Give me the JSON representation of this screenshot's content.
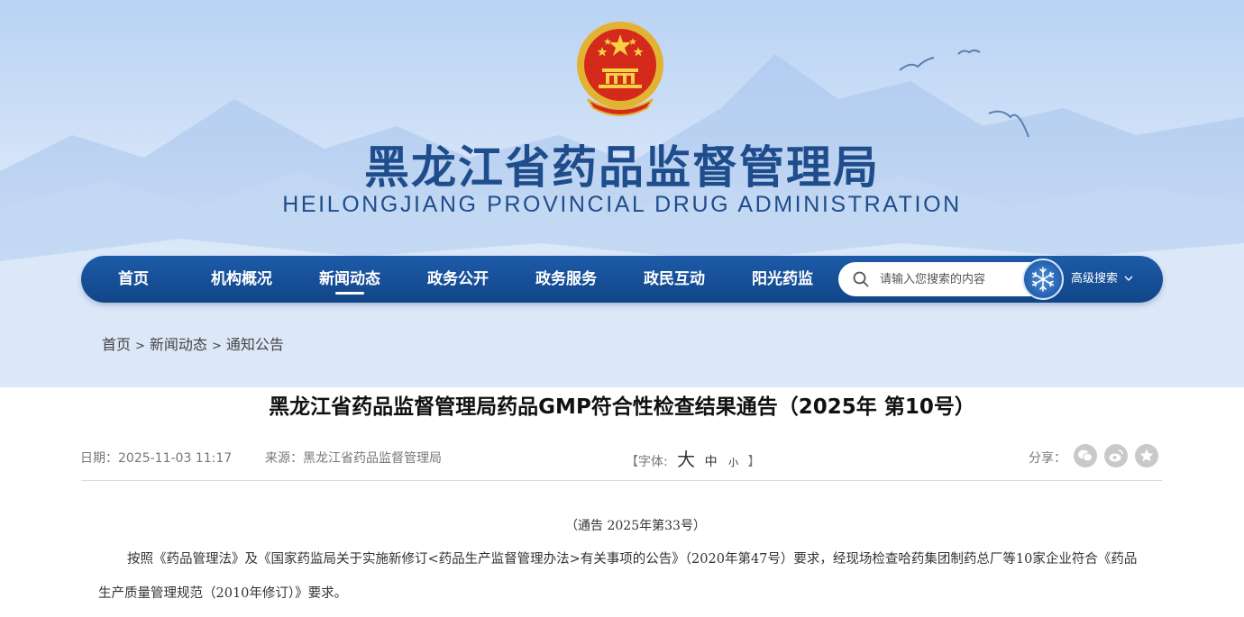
{
  "site": {
    "title": "黑龙江省药品监督管理局",
    "subtitle": "HEILONGJIANG PROVINCIAL DRUG ADMINISTRATION"
  },
  "nav": {
    "items": [
      {
        "label": "首页"
      },
      {
        "label": "机构概况"
      },
      {
        "label": "新闻动态",
        "active": true
      },
      {
        "label": "政务公开"
      },
      {
        "label": "政务服务"
      },
      {
        "label": "政民互动"
      },
      {
        "label": "阳光药监"
      }
    ],
    "search_placeholder": "请输入您搜索的内容",
    "advanced_search": "高级搜索"
  },
  "breadcrumb": {
    "items": [
      "首页",
      "新闻动态",
      "通知公告"
    ],
    "separator": ">"
  },
  "article": {
    "title": "黑龙江省药品监督管理局药品GMP符合性检查结果通告（2025年 第10号）",
    "date": "日期：2025-11-03 11:17",
    "source": "来源：黑龙江省药品监督管理局",
    "font_label_open": "【字体:",
    "font_large": "大",
    "font_medium": "中",
    "font_small": "小",
    "font_label_close": "】",
    "share_label": "分享：",
    "notice_number": "（通告 2025年第33号）",
    "paragraph": "按照《药品管理法》及《国家药监局关于实施新修订<药品生产监督管理办法>有关事项的公告》（2020年第47号）要求，经现场检查哈药集团制药总厂等10家企业符合《药品生产质量管理规范（2010年修订）》要求。"
  },
  "colors": {
    "nav_bg": "#114588",
    "title_blue": "#1f4d8c",
    "banner_top": "#b9d3f4"
  },
  "icons": [
    "national-emblem-icon",
    "search-icon",
    "snowflake-search-icon",
    "chevron-down-icon",
    "wechat-icon",
    "weibo-icon",
    "favorite-icon"
  ]
}
